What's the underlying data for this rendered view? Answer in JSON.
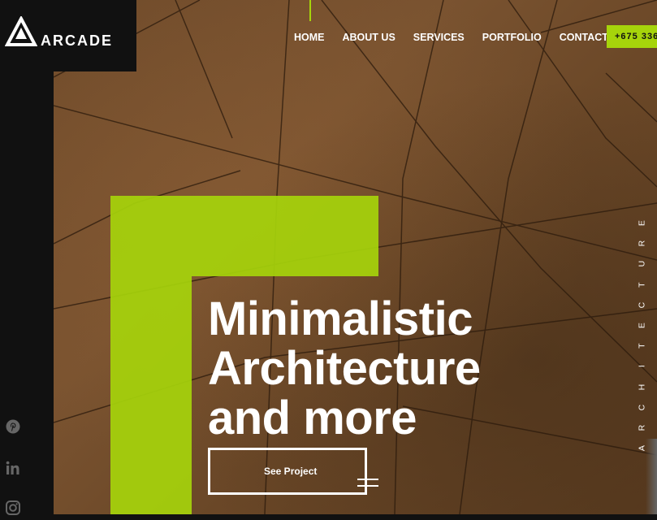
{
  "brand": {
    "name": "ARCADE"
  },
  "nav": {
    "items": [
      "HOME",
      "ABOUT US",
      "SERVICES",
      "PORTFOLIO",
      "CONTACT"
    ],
    "phone": "+675 336"
  },
  "hero": {
    "headline_lines": [
      "Minimalistic",
      "Architecture",
      "and more"
    ],
    "cta_label": "See Project",
    "vertical_label": "ARCHITECTURE"
  },
  "social": [
    "pinterest-icon",
    "linkedin-icon",
    "instagram-icon"
  ],
  "colors": {
    "accent": "#a6d40b",
    "dark": "#111111",
    "text": "#ffffff"
  }
}
